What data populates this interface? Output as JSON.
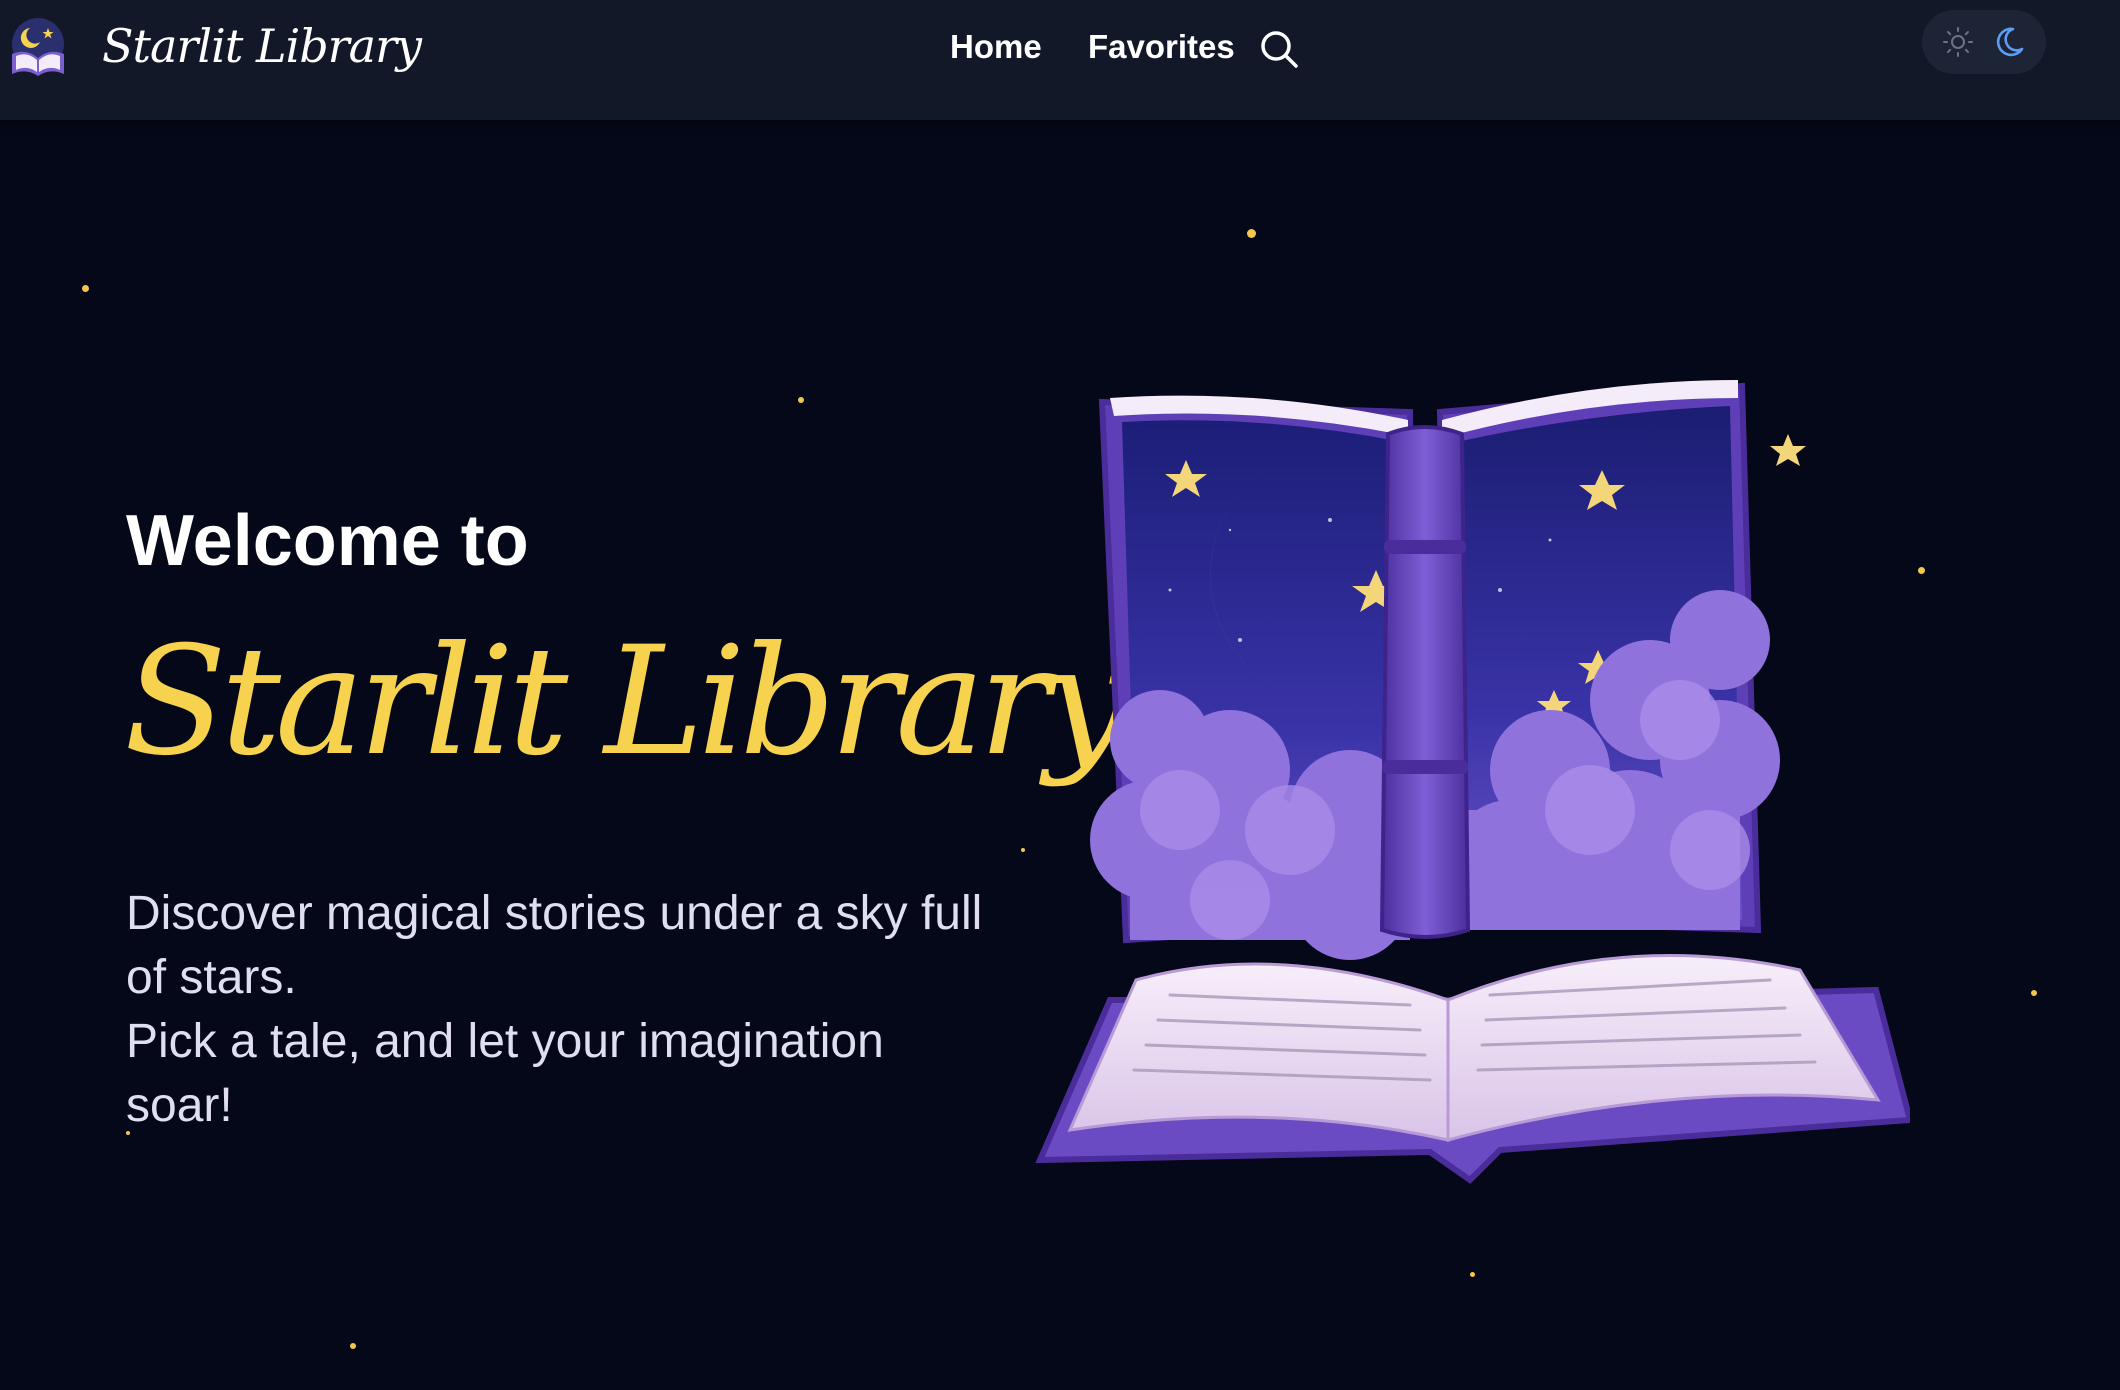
{
  "brand": {
    "name": "Starlit Library",
    "logo_icon": "open-book-moon-icon"
  },
  "nav": {
    "links": [
      {
        "label": "Home"
      },
      {
        "label": "Favorites"
      }
    ],
    "search_icon": "search-icon"
  },
  "theme_toggle": {
    "options": [
      "sun-icon",
      "moon-icon"
    ],
    "active": "moon-icon"
  },
  "hero": {
    "welcome": "Welcome to",
    "title": "Starlit Library",
    "description_line1": "Discover magical stories under a sky full of stars.",
    "description_line2": "Pick a tale, and let your imagination soar!",
    "illustration": "magical-open-book-night-sky"
  },
  "colors": {
    "background": "#050818",
    "navbar": "#121828",
    "accent_gold": "#f7d24e",
    "star_dot": "#f6c64a",
    "toggle_active": "#5b9df5",
    "book_purple": "#6a4bc4"
  }
}
